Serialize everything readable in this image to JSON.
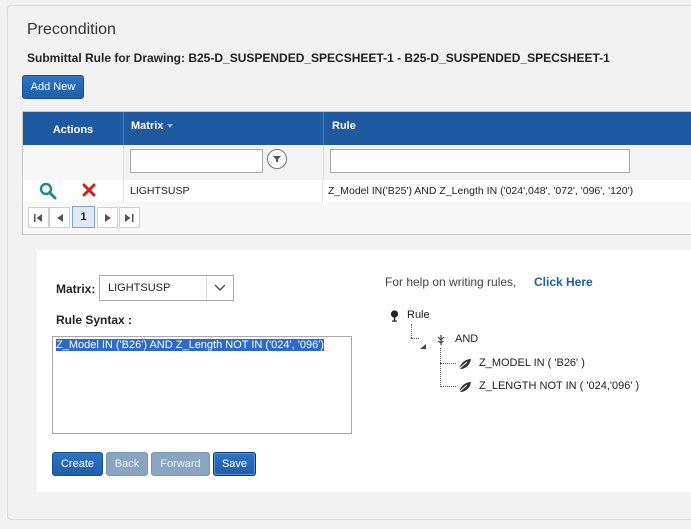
{
  "page": {
    "title": "Precondition",
    "subtitle": "Submittal Rule for Drawing: B25-D_SUSPENDED_SPECSHEET-1 - B25-D_SUSPENDED_SPECSHEET-1",
    "add_new_label": "Add New"
  },
  "grid": {
    "columns": {
      "actions": "Actions",
      "matrix": "Matrix",
      "rule": "Rule"
    },
    "filters": {
      "matrix": "",
      "rule": ""
    },
    "rows": [
      {
        "matrix": "LIGHTSUSP",
        "rule": "Z_Model IN('B25') AND Z_Length IN ('024',048', '072', '096', '120')"
      }
    ],
    "pager": {
      "current_page": "1"
    }
  },
  "editor": {
    "matrix_label": "Matrix:",
    "matrix_value": "LIGHTSUSP",
    "rule_syntax_label": "Rule Syntax :",
    "rule_syntax_value": "Z_Model IN ('B26') AND Z_Length NOT IN ('024', '096')",
    "help_text": "For help on writing rules,",
    "help_link": "Click Here",
    "tree": {
      "root": "Rule",
      "operator": "AND",
      "conditions": [
        "Z_MODEL IN ( 'B26' )",
        "Z_LENGTH NOT IN ( '024,'096' )"
      ]
    },
    "buttons": {
      "create": "Create",
      "back": "Back",
      "forward": "Forward",
      "save": "Save"
    }
  },
  "colors": {
    "header_blue": "#1f5aa0",
    "button_blue": "#2563b0",
    "delete_red": "#d21f1f",
    "search_teal": "#1b8a8e"
  },
  "icons": [
    "search-icon",
    "delete-icon",
    "filter-icon",
    "chevron-down-icon",
    "tree-root-icon",
    "tree-branch-icon",
    "leaf-icon",
    "first-page-icon",
    "prev-page-icon",
    "next-page-icon",
    "last-page-icon"
  ]
}
